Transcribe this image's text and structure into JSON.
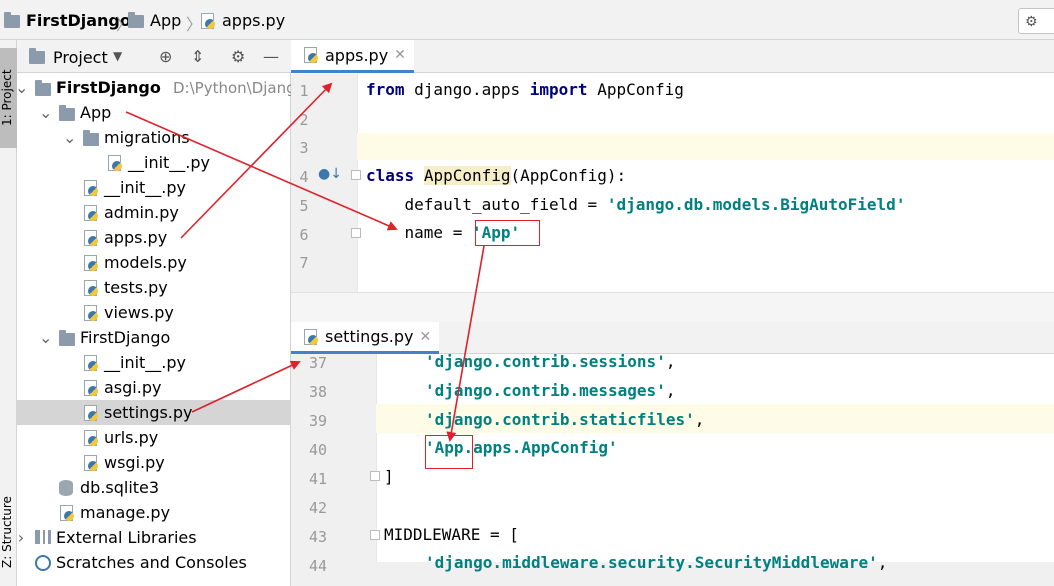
{
  "breadcrumb": {
    "project": "FirstDjango",
    "folder": "App",
    "file": "apps.py"
  },
  "left_stripe": {
    "project_tab": "1: Project",
    "structure_tab": "Z: Structure"
  },
  "project_panel": {
    "title": "Project",
    "tree": [
      {
        "label": "FirstDjango",
        "path": "D:\\Python\\Django",
        "type": "root"
      },
      {
        "label": "App",
        "type": "folder"
      },
      {
        "label": "migrations",
        "type": "folder"
      },
      {
        "label": "__init__.py",
        "type": "py"
      },
      {
        "label": "__init__.py",
        "type": "py"
      },
      {
        "label": "admin.py",
        "type": "py"
      },
      {
        "label": "apps.py",
        "type": "py"
      },
      {
        "label": "models.py",
        "type": "py"
      },
      {
        "label": "tests.py",
        "type": "py"
      },
      {
        "label": "views.py",
        "type": "py"
      },
      {
        "label": "FirstDjango",
        "type": "folder"
      },
      {
        "label": "__init__.py",
        "type": "py"
      },
      {
        "label": "asgi.py",
        "type": "py"
      },
      {
        "label": "settings.py",
        "type": "py"
      },
      {
        "label": "urls.py",
        "type": "py"
      },
      {
        "label": "wsgi.py",
        "type": "py"
      },
      {
        "label": "db.sqlite3",
        "type": "db"
      },
      {
        "label": "manage.py",
        "type": "py"
      },
      {
        "label": "External Libraries",
        "type": "lib"
      },
      {
        "label": "Scratches and Consoles",
        "type": "scratch"
      }
    ]
  },
  "editor_top": {
    "tab": "apps.py",
    "line_numbers": [
      "1",
      "2",
      "3",
      "4",
      "5",
      "6",
      "7"
    ],
    "lines": {
      "l1_kw1": "from",
      "l1_mid": " django.apps ",
      "l1_kw2": "import",
      "l1_end": " AppConfig",
      "l4_kw": "class",
      "l4_name": "AppConfig",
      "l4_end": "(AppConfig):",
      "l5_pre": "    default_auto_field = ",
      "l5_str": "'django.db.models.BigAutoField'",
      "l6_pre": "    name = ",
      "l6_str": "'App'"
    }
  },
  "editor_bottom": {
    "tab": "settings.py",
    "line_numbers": [
      "37",
      "38",
      "39",
      "40",
      "41",
      "42",
      "43",
      "44"
    ],
    "lines": {
      "l37": "'django.contrib.sessions'",
      "l38": "'django.contrib.messages'",
      "l39": "'django.contrib.staticfiles'",
      "l40_a": "'App.",
      "l40_b": "apps.AppConfig'",
      "l41": "]",
      "l43": "MIDDLEWARE = [",
      "l44": "'django.middleware.security.SecurityMiddleware'",
      "comma": ","
    }
  },
  "colors": {
    "keyword": "#000080",
    "string": "#008080",
    "annotation": "#e0202a",
    "tab_underline": "#4083c9"
  }
}
